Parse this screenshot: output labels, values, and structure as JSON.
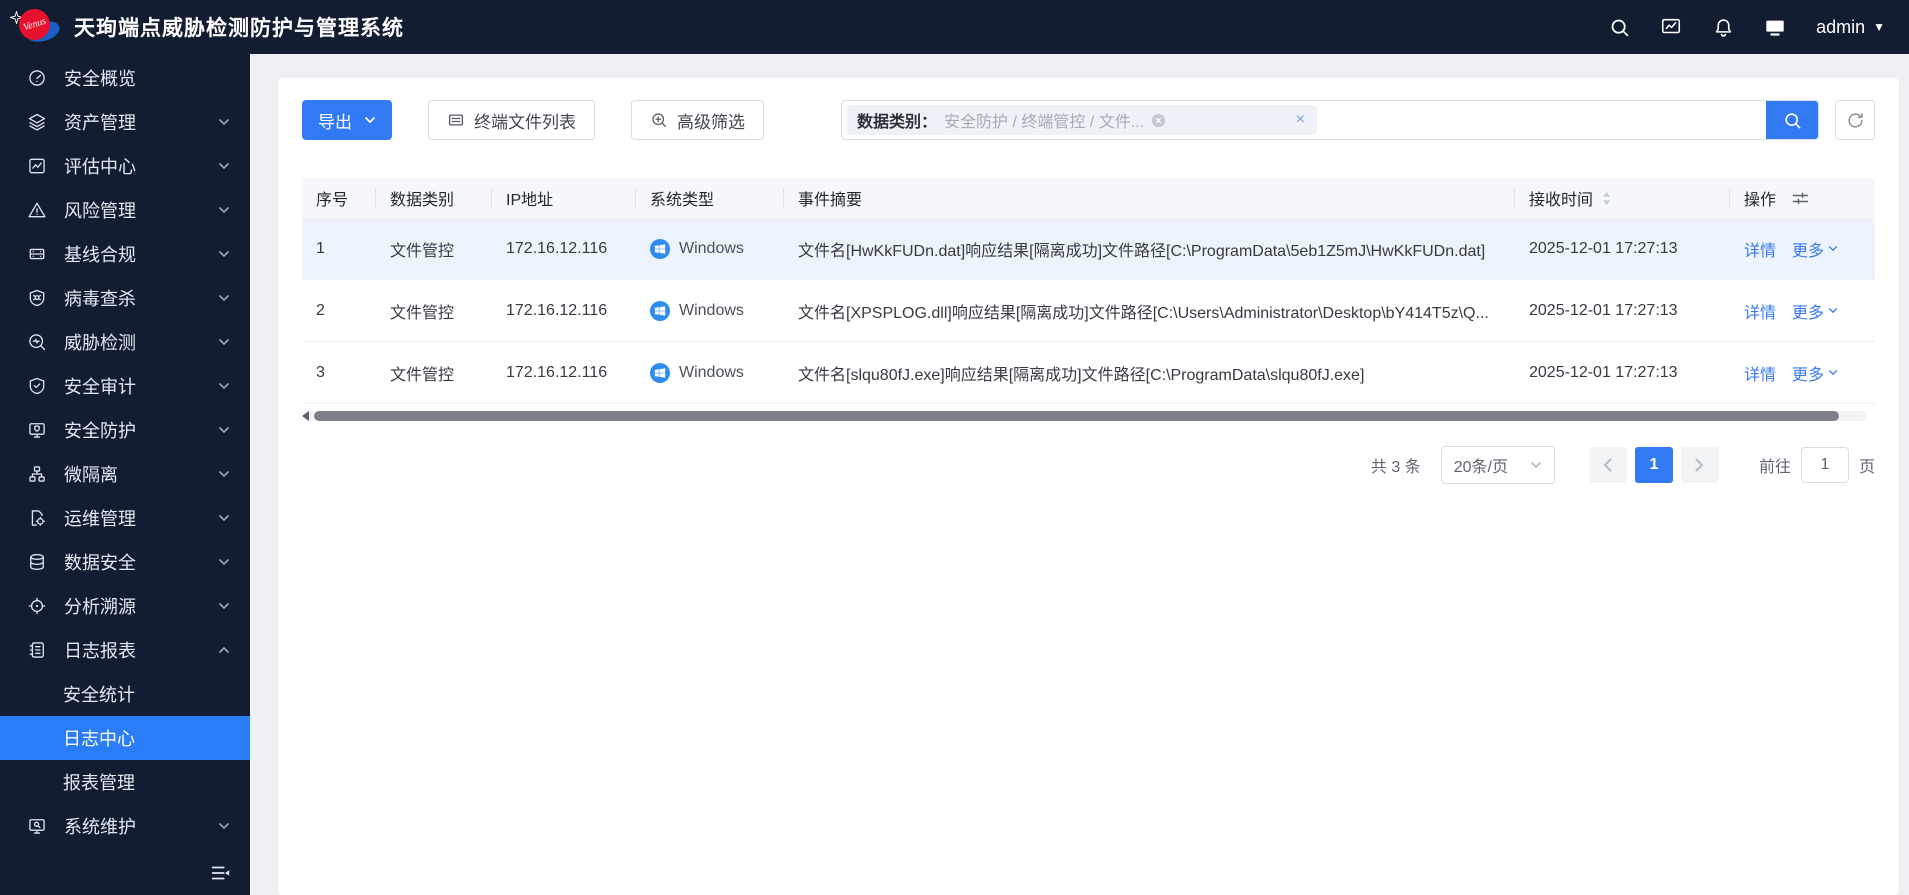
{
  "header": {
    "title": "天珣端点威胁检测防护与管理系统",
    "user": "admin"
  },
  "sidebar": {
    "items": [
      {
        "label": "安全概览"
      },
      {
        "label": "资产管理"
      },
      {
        "label": "评估中心"
      },
      {
        "label": "风险管理"
      },
      {
        "label": "基线合规"
      },
      {
        "label": "病毒查杀"
      },
      {
        "label": "威胁检测"
      },
      {
        "label": "安全审计"
      },
      {
        "label": "安全防护"
      },
      {
        "label": "微隔离"
      },
      {
        "label": "运维管理"
      },
      {
        "label": "数据安全"
      },
      {
        "label": "分析溯源"
      },
      {
        "label": "日志报表",
        "expanded": true,
        "children": [
          {
            "label": "安全统计"
          },
          {
            "label": "日志中心",
            "active": true
          },
          {
            "label": "报表管理"
          }
        ]
      },
      {
        "label": "系统维护"
      }
    ]
  },
  "toolbar": {
    "export": "导出",
    "terminal_list": "终端文件列表",
    "advanced_filter": "高级筛选"
  },
  "filter_tag": {
    "label": "数据类别：",
    "value": "安全防护 / 终端管控 / 文件...",
    "close": "×"
  },
  "table": {
    "columns": {
      "no": "序号",
      "category": "数据类别",
      "ip": "IP地址",
      "os": "系统类型",
      "summary": "事件摘要",
      "time": "接收时间",
      "action": "操作"
    },
    "rows": [
      {
        "no": "1",
        "category": "文件管控",
        "ip": "172.16.12.116",
        "os": "Windows",
        "summary": "文件名[HwKkFUDn.dat]响应结果[隔离成功]文件路径[C:\\ProgramData\\5eb1Z5mJ\\HwKkFUDn.dat]",
        "time": "2025-12-01 17:27:13",
        "detail": "详情",
        "more": "更多"
      },
      {
        "no": "2",
        "category": "文件管控",
        "ip": "172.16.12.116",
        "os": "Windows",
        "summary": "文件名[XPSPLOG.dll]响应结果[隔离成功]文件路径[C:\\Users\\Administrator\\Desktop\\bY414T5z\\Q...",
        "time": "2025-12-01 17:27:13",
        "detail": "详情",
        "more": "更多"
      },
      {
        "no": "3",
        "category": "文件管控",
        "ip": "172.16.12.116",
        "os": "Windows",
        "summary": "文件名[slqu80fJ.exe]响应结果[隔离成功]文件路径[C:\\ProgramData\\slqu80fJ.exe]",
        "time": "2025-12-01 17:27:13",
        "detail": "详情",
        "more": "更多"
      }
    ]
  },
  "pagination": {
    "total": "共 3 条",
    "page_size": "20条/页",
    "page": "1",
    "goto_label": "前往",
    "goto_value": "1",
    "goto_unit": "页"
  },
  "colors": {
    "primary": "#3279f4",
    "header_bg": "#131d31",
    "menu_active": "#2a7cf7",
    "link": "#3a7af0",
    "windows_icon": "#2f8cee",
    "row_highlight": "#edf3fc"
  }
}
